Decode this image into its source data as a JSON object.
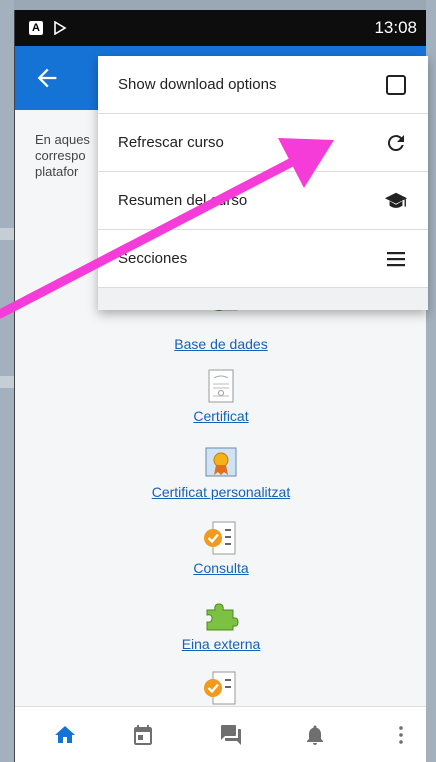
{
  "status_bar": {
    "time": "13:08",
    "notification_a": "A"
  },
  "header": {
    "back_icon": "arrow-left-icon",
    "color": "#1673d6"
  },
  "intro_text": [
    "En aques",
    "correspo",
    "platafor"
  ],
  "modules": [
    {
      "label": "Base de dades",
      "icon": "database-icon"
    },
    {
      "label": "Certificat",
      "icon": "certificate-icon"
    },
    {
      "label": "Certificat personalitzat",
      "icon": "custom-certificate-icon"
    },
    {
      "label": "Consulta",
      "icon": "choice-icon"
    },
    {
      "label": "Eina externa",
      "icon": "external-tool-icon"
    }
  ],
  "menu": {
    "items": [
      {
        "label": "Show download options",
        "icon": "checkbox-icon"
      },
      {
        "label": "Refrescar curso",
        "icon": "refresh-icon"
      },
      {
        "label": "Resumen del curso",
        "icon": "graduation-cap-icon"
      },
      {
        "label": "Secciones",
        "icon": "hamburger-menu-icon"
      }
    ]
  },
  "bottom_nav": [
    {
      "name": "home",
      "icon": "home-icon",
      "active": true
    },
    {
      "name": "calendar",
      "icon": "calendar-icon",
      "active": false
    },
    {
      "name": "messages",
      "icon": "messages-icon",
      "active": false
    },
    {
      "name": "notifications",
      "icon": "bell-icon",
      "active": false
    },
    {
      "name": "more",
      "icon": "more-vertical-icon",
      "active": false
    }
  ],
  "colors": {
    "accent": "#1673d6",
    "link": "#1461b8",
    "annotation_arrow": "#f53cd8"
  }
}
